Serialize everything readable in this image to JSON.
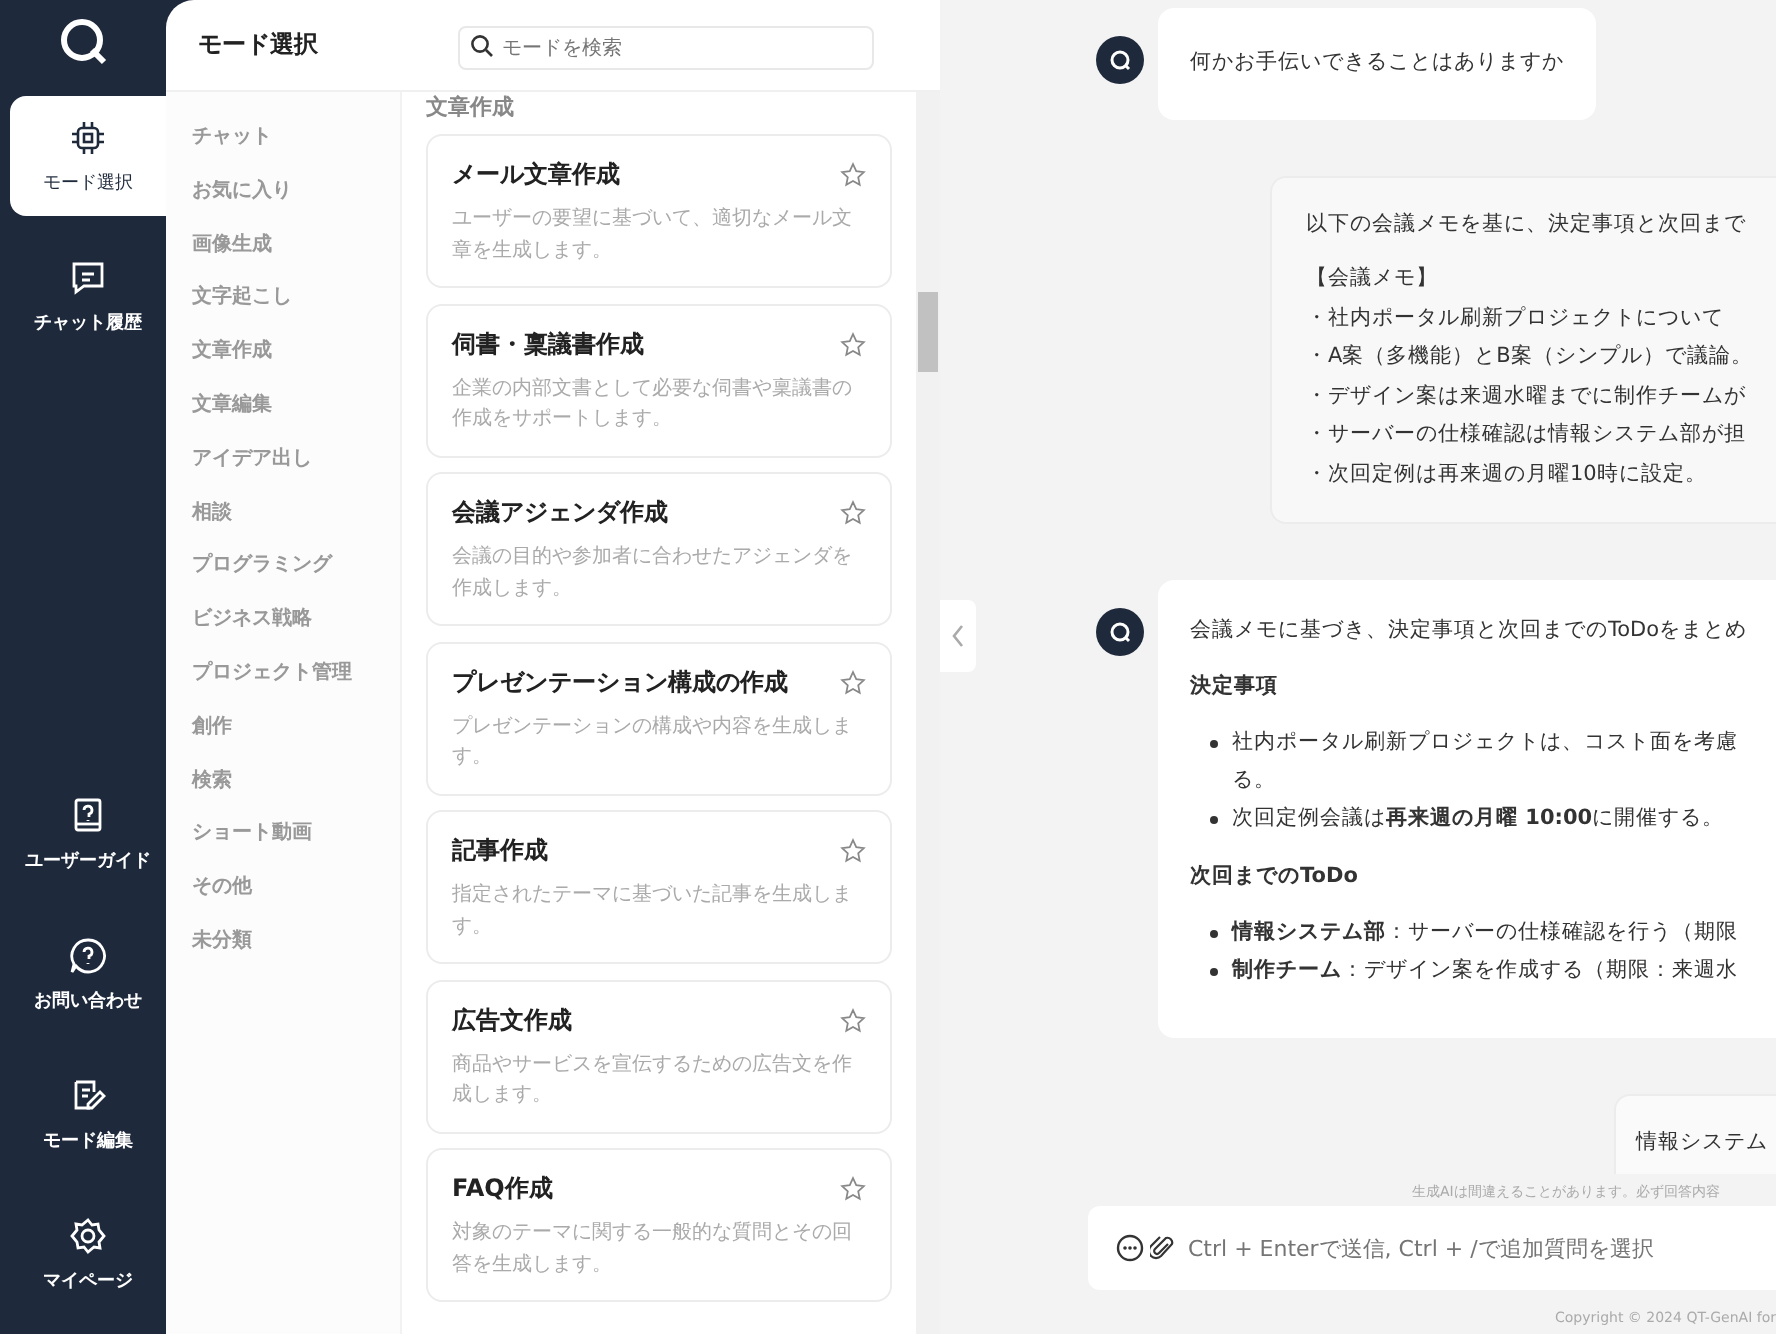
{
  "nav": {
    "top": [
      {
        "label": "モード選択",
        "selected": true
      },
      {
        "label": "チャット履歴",
        "selected": false
      }
    ],
    "bottom": [
      {
        "label": "ユーザーガイド",
        "selected": false
      },
      {
        "label": "お問い合わせ",
        "selected": false
      },
      {
        "label": "モード編集",
        "selected": false
      },
      {
        "label": "マイページ",
        "selected": false
      }
    ]
  },
  "mode_panel": {
    "title": "モード選択",
    "search": {
      "placeholder": "モードを検索"
    },
    "categories": [
      {
        "label": "チャット"
      },
      {
        "label": "お気に入り"
      },
      {
        "label": "画像生成"
      },
      {
        "label": "文字起こし"
      },
      {
        "label": "文章作成"
      },
      {
        "label": "文章編集"
      },
      {
        "label": "アイデア出し"
      },
      {
        "label": "相談"
      },
      {
        "label": "プログラミング"
      },
      {
        "label": "ビジネス戦略"
      },
      {
        "label": "プロジェクト管理"
      },
      {
        "label": "創作"
      },
      {
        "label": "検索"
      },
      {
        "label": "ショート動画"
      },
      {
        "label": "その他"
      },
      {
        "label": "未分類"
      }
    ],
    "section_title": "文章作成",
    "cards": [
      {
        "title": "メール文章作成",
        "description": "ユーザーの要望に基づいて、適切なメール文章を生成します。",
        "favorite": false
      },
      {
        "title": "伺書・稟議書作成",
        "description": "企業の内部文書として必要な伺書や稟議書の作成をサポートします。",
        "favorite": false
      },
      {
        "title": "会議アジェンダ作成",
        "description": "会議の目的や参加者に合わせたアジェンダを作成します。",
        "favorite": false
      },
      {
        "title": "プレゼンテーション構成の作成",
        "description": "プレゼンテーションの構成や内容を生成します。",
        "favorite": false
      },
      {
        "title": "記事作成",
        "description": "指定されたテーマに基づいた記事を生成します。",
        "favorite": false
      },
      {
        "title": "広告文作成",
        "description": "商品やサービスを宣伝するための広告文を作成します。",
        "favorite": false
      },
      {
        "title": "FAQ作成",
        "description": "対象のテーマに関する一般的な質問とその回答を生成します。",
        "favorite": false
      }
    ]
  },
  "chat": {
    "messages": [
      {
        "kind": "assistant",
        "lines": [
          "何かお手伝いできることはありますか"
        ]
      },
      {
        "kind": "user",
        "paragraphs": [
          [
            "以下の会議メモを基に、決定事項と次回まで"
          ],
          [
            "【会議メモ】",
            "・社内ポータル刷新プロジェクトについて",
            "・A案（多機能）とB案（シンプル）で議論。",
            "・デザイン案は来週水曜までに制作チームが",
            "・サーバーの仕様確認は情報システム部が担",
            "・次回定例は再来週の月曜10時に設定。"
          ]
        ]
      },
      {
        "kind": "assistant",
        "blocks": [
          {
            "kind": "paragraph",
            "text": "会議メモに基づき、決定事項と次回までのToDoをまとめ"
          },
          {
            "kind": "heading",
            "text": "決定事項"
          },
          {
            "kind": "bullets",
            "items": [
              {
                "lines": [
                  "社内ポータル刷新プロジェクトは、コスト面を考慮",
                  "る。"
                ]
              },
              {
                "lines": [
                  "次回定例会議は**再来週の月曜 10:00**に開催する。"
                ]
              }
            ]
          },
          {
            "kind": "heading",
            "text": "次回までのToDo"
          },
          {
            "kind": "bullets",
            "items": [
              {
                "lines": [
                  "**情報システム部**：サーバーの仕様確認を行う（期限"
                ]
              },
              {
                "lines": [
                  "**制作チーム**：デザイン案を作成する（期限：来週水"
                ]
              }
            ]
          }
        ]
      },
      {
        "kind": "user",
        "paragraphs": [
          [
            "情報システム"
          ]
        ]
      }
    ],
    "disclaimer": "生成AIは間違えることがあります。必ず回答内容",
    "input": {
      "placeholder": "Ctrl + Enterで送信, Ctrl + /で追加質問を選択"
    },
    "copyright": "Copyright © 2024 QT-GenAI for"
  }
}
